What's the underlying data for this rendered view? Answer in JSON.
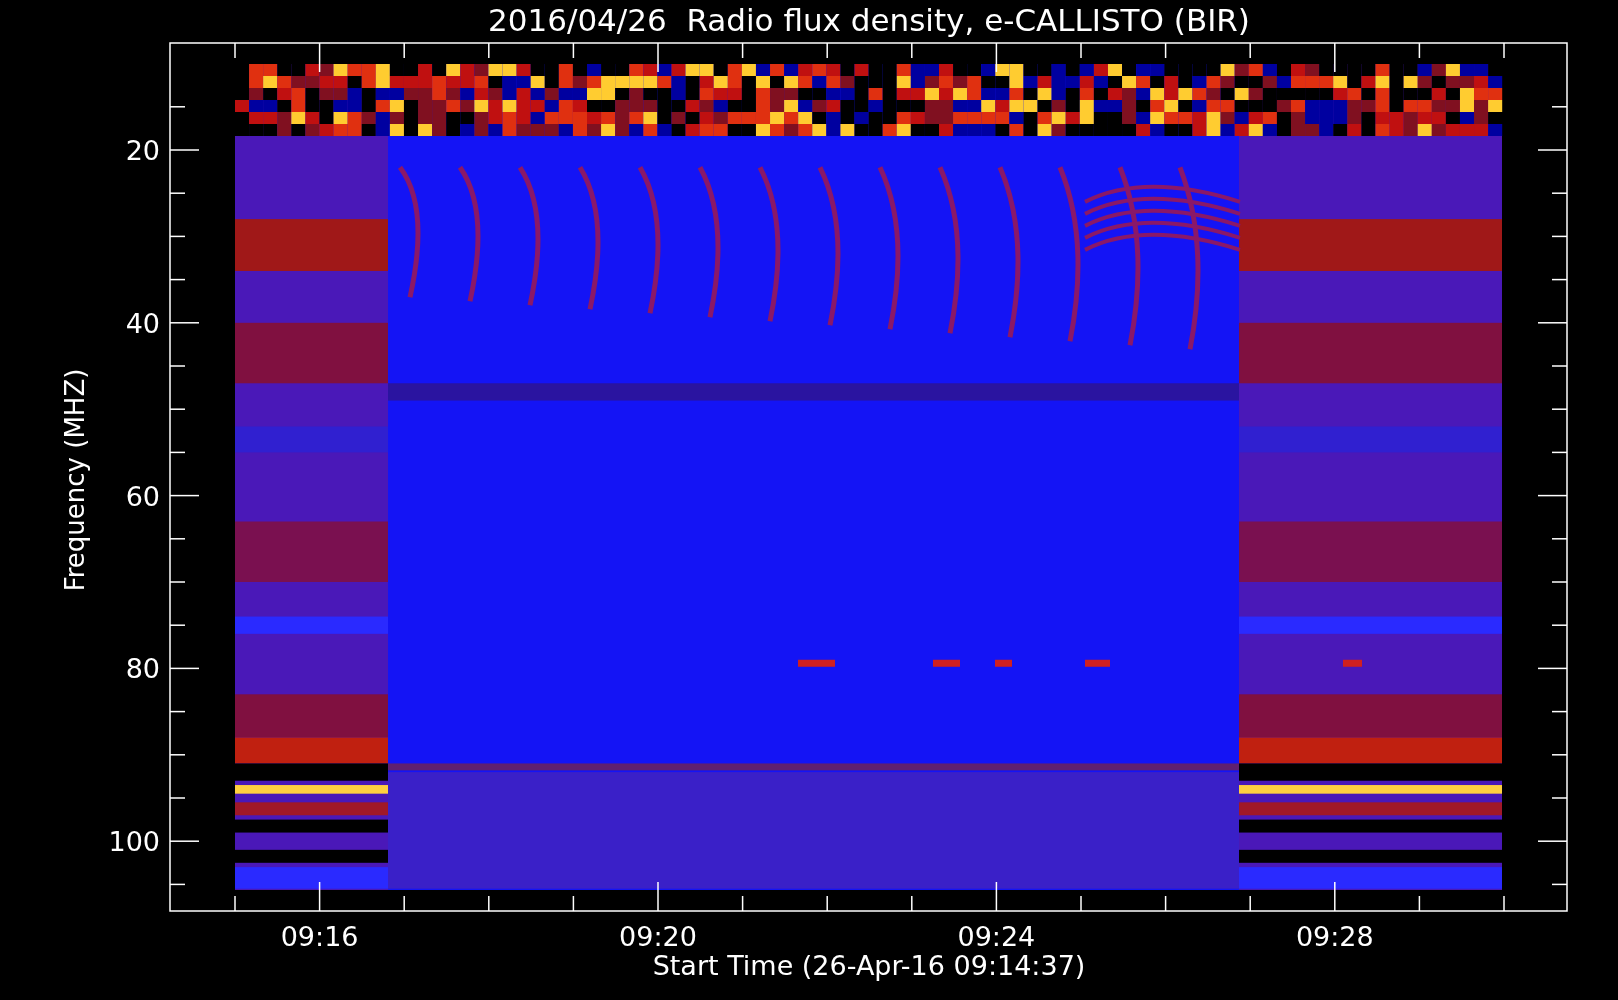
{
  "title": "2016/04/26  Radio flux density, e-CALLISTO (BIR)",
  "y_axis": {
    "label": "Frequency (MHZ)",
    "ticks": [
      "20",
      "40",
      "60",
      "80",
      "100"
    ]
  },
  "x_axis": {
    "label": "Start Time (26-Apr-16 09:14:37)",
    "ticks": [
      "09:16",
      "09:20",
      "09:24",
      "09:28"
    ]
  }
}
